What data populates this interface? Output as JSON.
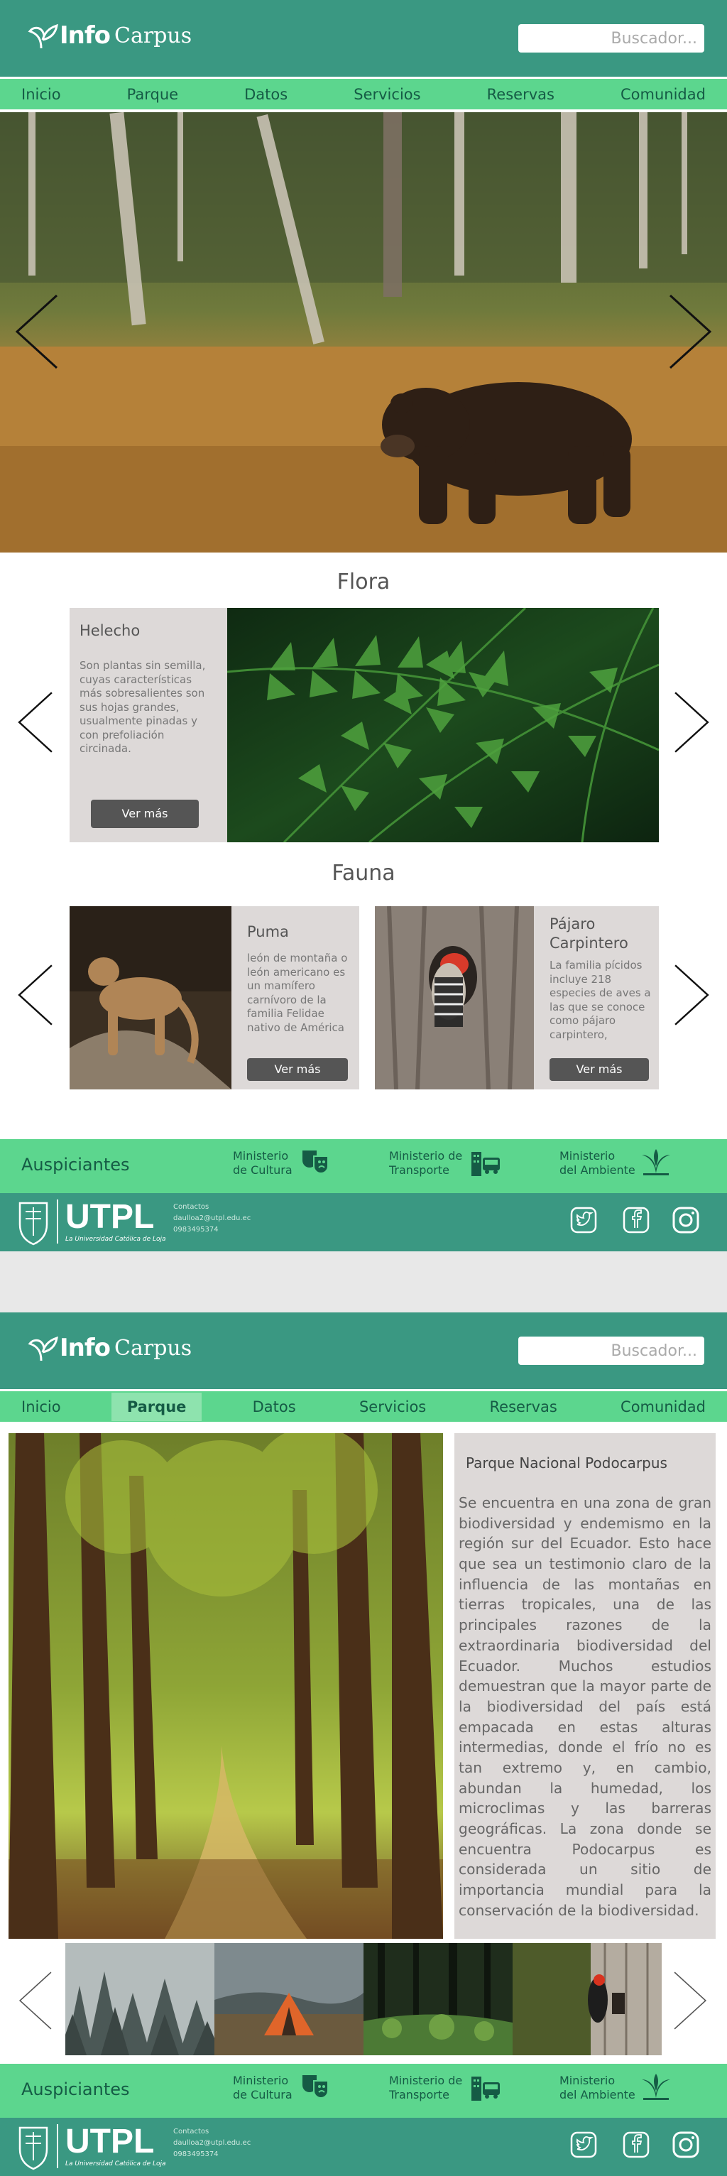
{
  "header": {
    "logo_word1": "Info",
    "logo_word2": "Carpus",
    "search_placeholder": "Buscador..."
  },
  "nav": [
    "Inicio",
    "Parque",
    "Datos",
    "Servicios",
    "Reservas",
    "Comunidad"
  ],
  "page1": {
    "flora_title": "Flora",
    "flora_card": {
      "title": "Helecho",
      "desc": "Son plantas  sin semilla, cuyas características  más sobresalientes son sus hojas grandes, usualmente pinadas y con prefoliación circinada.",
      "button": "Ver más"
    },
    "fauna_title": "Fauna",
    "fauna_cards": [
      {
        "title": "Puma",
        "desc": "león de montaña o león americano  es un mamífero carnívoro de la familia Felidae nativo de América",
        "button": "Ver más"
      },
      {
        "title": "Pájaro Carpintero",
        "desc": "La familia pícidos incluye 218 especies de aves a las que se conoce como pájaro carpintero,",
        "button": "Ver más"
      }
    ]
  },
  "sponsors": {
    "label": "Auspiciantes",
    "items": [
      {
        "line1": "Ministerio",
        "line2": "de Cultura",
        "icon": "theater-masks-icon"
      },
      {
        "line1": "Ministerio de",
        "line2": "Transporte",
        "icon": "bus-building-icon"
      },
      {
        "line1": "Ministerio",
        "line2": "del Ambiente",
        "icon": "plant-icon"
      }
    ]
  },
  "footer": {
    "utpl": "UTPL",
    "utpl_sub": "La Universidad Católica de Loja",
    "contact_title": "Contactos",
    "contact_email": "daulloa2@utpl.edu.ec",
    "contact_phone": "0983495374"
  },
  "page2": {
    "park_title": "Parque Nacional Podocarpus",
    "park_body": "Se encuentra en una zona de gran biodiversidad y endemismo en la región sur del Ecuador. Esto hace que sea un testimonio claro de la influencia de las montañas en tierras tropicales, una de las principales razones de la extraordinaria biodiversidad del Ecuador. Muchos estudios demuestran que la mayor parte de la biodiversidad del país está empacada en estas alturas intermedias, donde el frío no es tan extremo y, en cambio, abundan la humedad, los microclimas y las barreras geográficas. La zona donde se encuentra Podocarpus es considerada un sitio de importancia mundial para la conservación de la biodiversidad."
  },
  "colors": {
    "header": "#3a9882",
    "nav": "#5cd68e",
    "card": "#ddd9d8",
    "button": "#555555"
  }
}
